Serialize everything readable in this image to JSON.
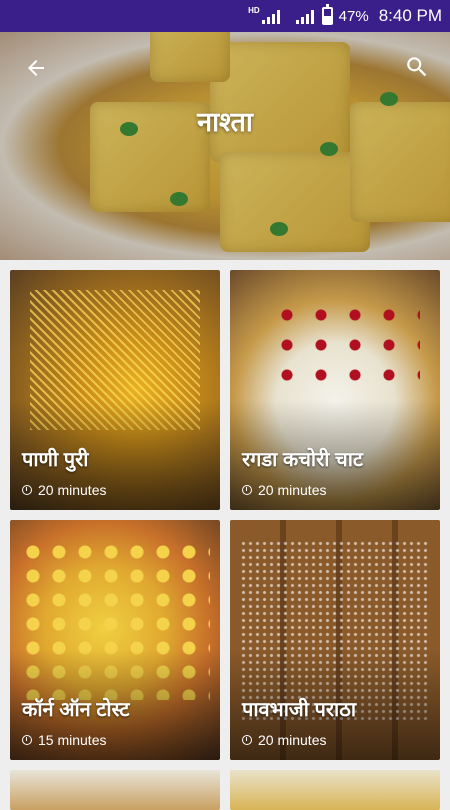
{
  "status_bar": {
    "network": "HD",
    "battery_percent": "47%",
    "battery_level": 0.47,
    "time": "8:40 PM",
    "background_color": "#3a1f8a"
  },
  "header": {
    "title": "नाश्ता",
    "back_icon": "arrow-left-icon",
    "search_icon": "search-icon"
  },
  "recipes": [
    {
      "name": "पाणी पुरी",
      "time": "20 minutes"
    },
    {
      "name": "रगडा कचोरी चाट",
      "time": "20 minutes"
    },
    {
      "name": "कॉर्न ऑन टोस्ट",
      "time": "15 minutes"
    },
    {
      "name": "पावभाजी पराठा",
      "time": "20 minutes"
    }
  ]
}
